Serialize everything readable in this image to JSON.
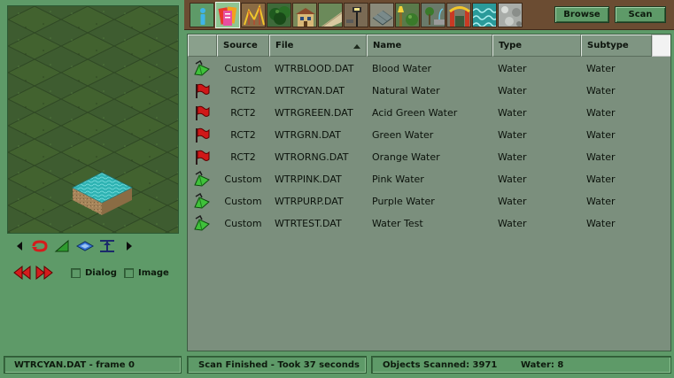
{
  "toolbar": {
    "tabs": [
      {
        "icon": "info-icon"
      },
      {
        "icon": "ride-tickets-icon"
      },
      {
        "icon": "rollercoaster-icon"
      },
      {
        "icon": "tree-icon"
      },
      {
        "icon": "building-icon"
      },
      {
        "icon": "footpath-icon"
      },
      {
        "icon": "path-lamp-icon"
      },
      {
        "icon": "scenery-wall-icon"
      },
      {
        "icon": "small-scenery-icon"
      },
      {
        "icon": "fountain-icon"
      },
      {
        "icon": "park-entrance-icon"
      },
      {
        "icon": "water-icon"
      },
      {
        "icon": "terrain-icon"
      }
    ],
    "browse_label": "Browse",
    "scan_label": "Scan"
  },
  "preview": {
    "object_name": "WTRCYAN.DAT"
  },
  "preview_controls": {
    "dialog_label": "Dialog",
    "image_label": "Image",
    "dialog_checked": false,
    "image_checked": false
  },
  "list": {
    "columns": {
      "source": "Source",
      "file": "File",
      "name": "Name",
      "type": "Type",
      "subtype": "Subtype"
    },
    "sorted_column": "file",
    "rows": [
      {
        "flag": "green",
        "source": "Custom",
        "file": "WTRBLOOD.DAT",
        "name": "Blood Water",
        "type": "Water",
        "subtype": "Water"
      },
      {
        "flag": "red",
        "source": "RCT2",
        "file": "WTRCYAN.DAT",
        "name": "Natural Water",
        "type": "Water",
        "subtype": "Water"
      },
      {
        "flag": "red",
        "source": "RCT2",
        "file": "WTRGREEN.DAT",
        "name": "Acid Green Water",
        "type": "Water",
        "subtype": "Water"
      },
      {
        "flag": "red",
        "source": "RCT2",
        "file": "WTRGRN.DAT",
        "name": "Green Water",
        "type": "Water",
        "subtype": "Water"
      },
      {
        "flag": "red",
        "source": "RCT2",
        "file": "WTRORNG.DAT",
        "name": "Orange Water",
        "type": "Water",
        "subtype": "Water"
      },
      {
        "flag": "green",
        "source": "Custom",
        "file": "WTRPINK.DAT",
        "name": "Pink Water",
        "type": "Water",
        "subtype": "Water"
      },
      {
        "flag": "green",
        "source": "Custom",
        "file": "WTRPURP.DAT",
        "name": "Purple Water",
        "type": "Water",
        "subtype": "Water"
      },
      {
        "flag": "green",
        "source": "Custom",
        "file": "WTRTEST.DAT",
        "name": "Water Test",
        "type": "Water",
        "subtype": "Water"
      }
    ]
  },
  "status": {
    "frame": "WTRCYAN.DAT - frame 0",
    "scan": "Scan Finished - Took 37 seconds",
    "objects": "Objects Scanned: 3971",
    "water": "Water: 8"
  },
  "colors": {
    "window_bg": "#5e9a68",
    "list_bg": "#7b8f7d",
    "tab_strip_bg": "#6b4c32",
    "flag_red": "#d01818",
    "flag_green": "#3fc13a",
    "water_cyan": "#2fb3b3"
  }
}
